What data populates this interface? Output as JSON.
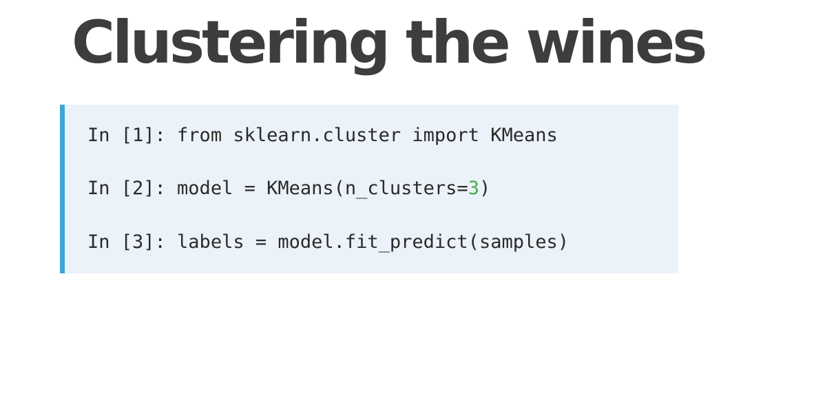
{
  "slide": {
    "title": "Clustering the wines"
  },
  "code": {
    "lines": [
      {
        "prompt": "In [1]: ",
        "code": "from sklearn.cluster import KMeans"
      },
      {
        "prompt": "In [2]: ",
        "code_before": "model = KMeans(n_clusters=",
        "number": "3",
        "code_after": ")"
      },
      {
        "prompt": "In [3]: ",
        "code": "labels = model.fit_predict(samples)"
      }
    ]
  },
  "colors": {
    "accent_bar": "#3da6d1",
    "code_background": "#ebf2f9",
    "number_literal": "#4caa4e",
    "title": "#3d3d3d"
  }
}
